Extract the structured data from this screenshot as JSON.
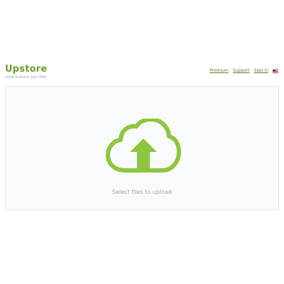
{
  "brand": {
    "title": "Upstore",
    "tagline": "store & share your files"
  },
  "nav": {
    "links": [
      "Premium",
      "Support",
      "Sign in"
    ],
    "language_flag_icon": "us-flag-icon"
  },
  "upload": {
    "icon": "cloud-upload-icon",
    "label": "Select files to upload"
  },
  "colors": {
    "brand_green": "#6f9e2f",
    "icon_green": "#8dc63f",
    "muted_text": "#a1a6ab"
  }
}
